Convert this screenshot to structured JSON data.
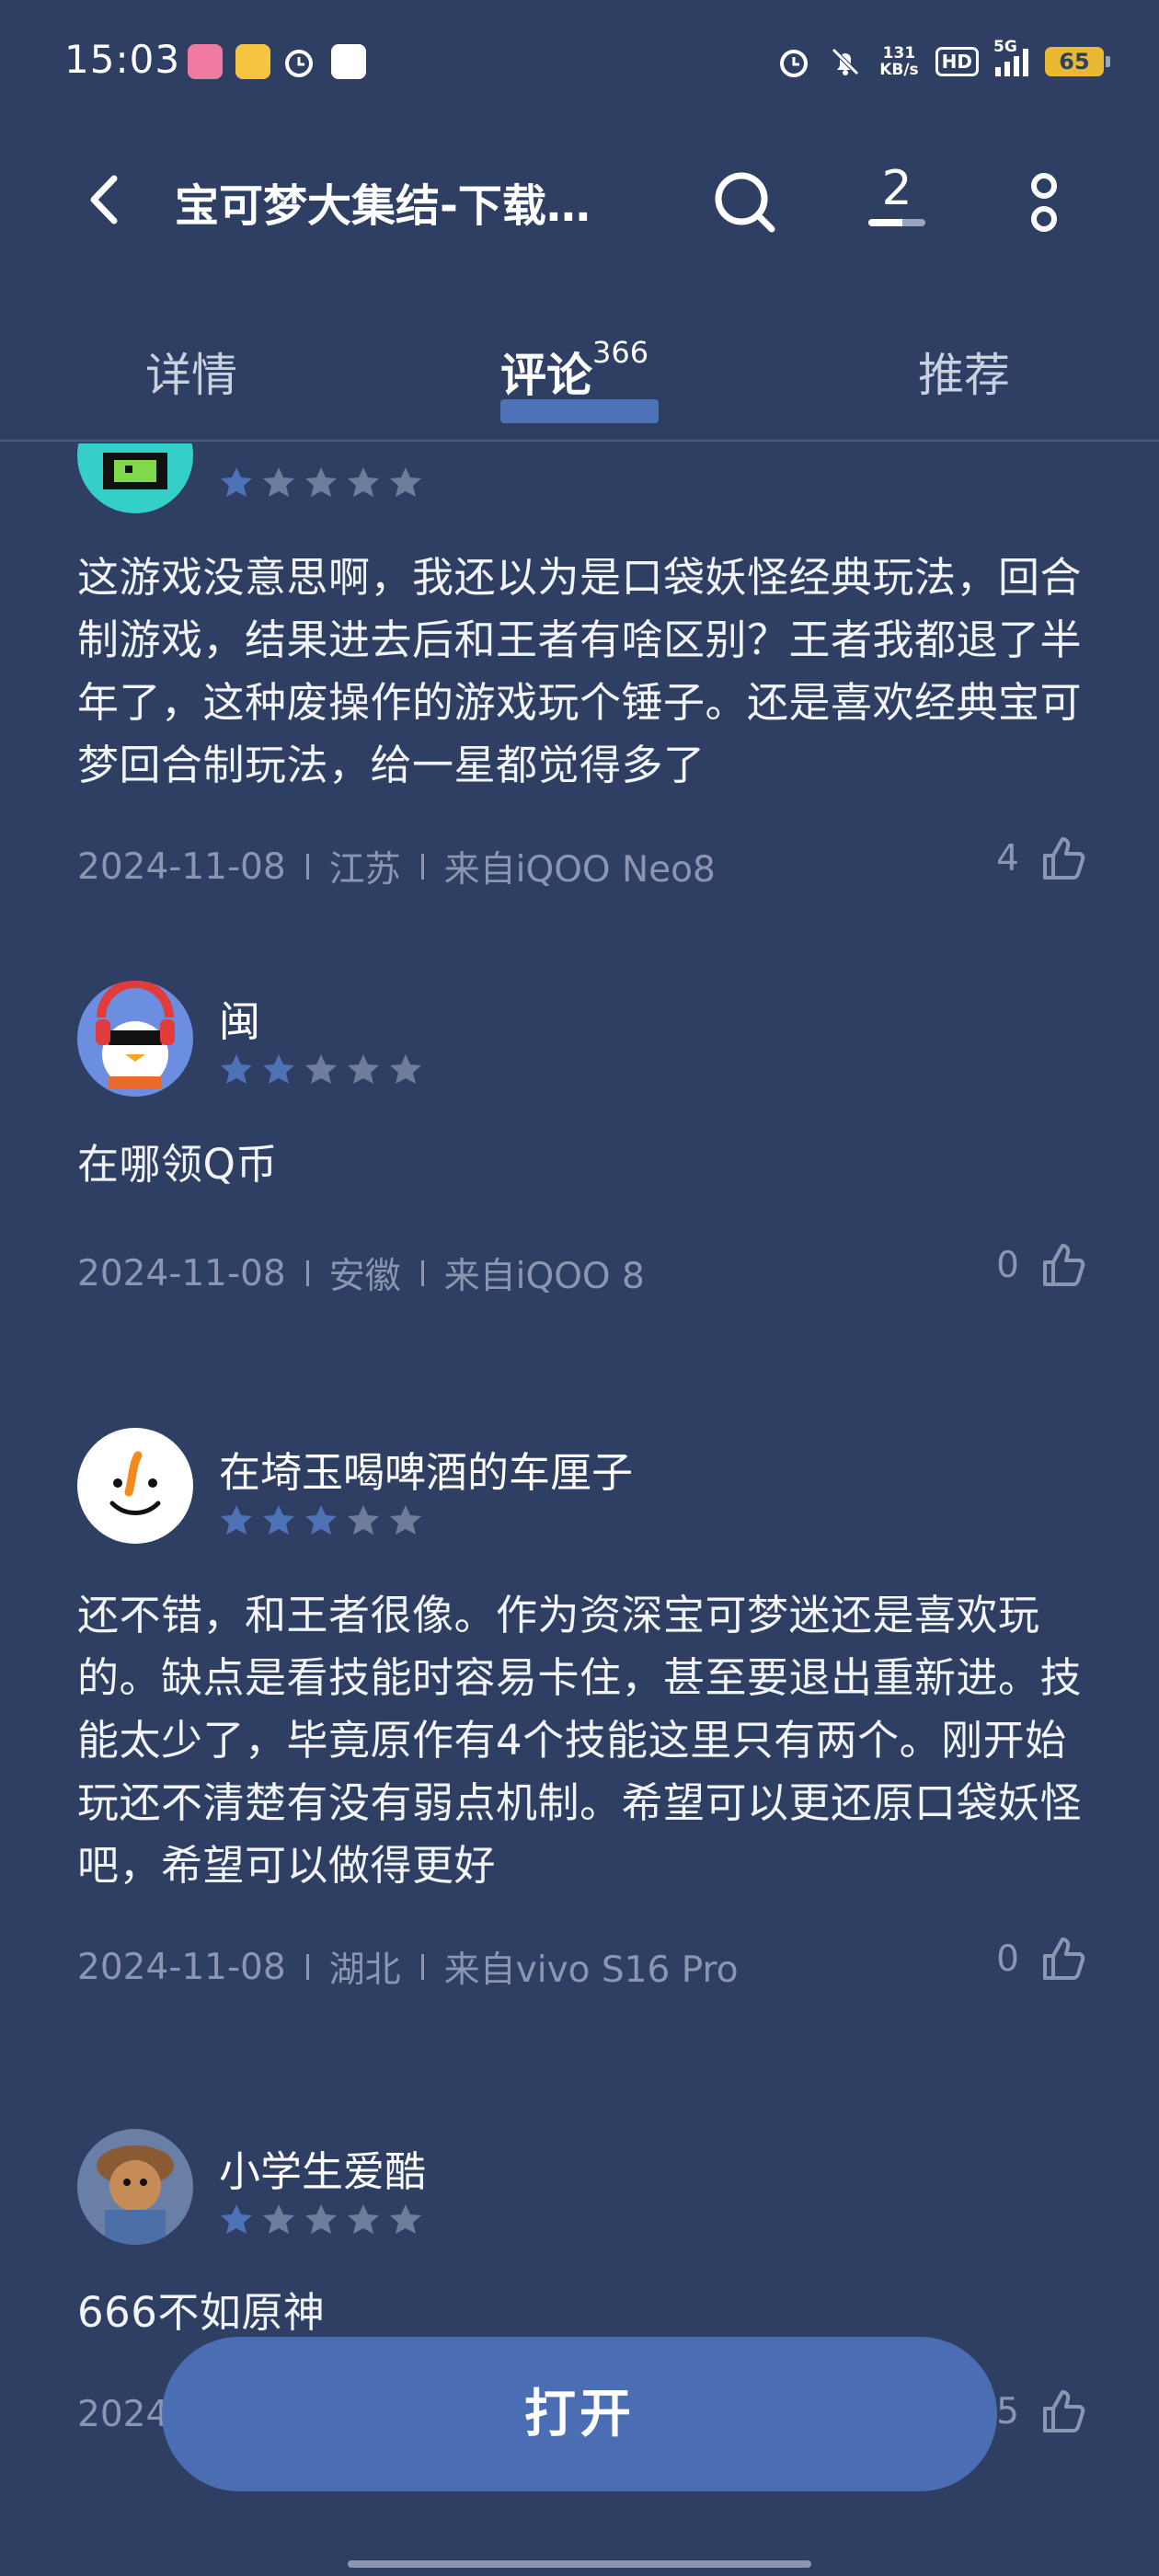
{
  "status": {
    "time": "15:03",
    "net_speed_top": "131",
    "net_speed_unit": "KB/s",
    "hd": "HD",
    "network": "5G",
    "battery": "65",
    "icons": [
      "bilibili-icon",
      "weibo-icon",
      "alarm-icon",
      "app-store-icon",
      "alarm-icon",
      "mute-bell-icon"
    ]
  },
  "header": {
    "title": "宝可梦大集结-下载…",
    "count": "2"
  },
  "tabs": [
    {
      "label": "详情"
    },
    {
      "label": "评论",
      "badge": "366"
    },
    {
      "label": "推荐"
    }
  ],
  "reviews": [
    {
      "rating": 1,
      "text": "这游戏没意思啊，我还以为是口袋妖怪经典玩法，回合制游戏，结果进去后和王者有啥区别？王者我都退了半年了，这种废操作的游戏玩个锤子。还是喜欢经典宝可梦回合制玩法，给一星都觉得多了",
      "date": "2024-11-08",
      "region": "江苏",
      "device": "来自iQOO Neo8",
      "likes": "4"
    },
    {
      "name": "闽",
      "rating": 2,
      "text": "在哪领Q币",
      "date": "2024-11-08",
      "region": "安徽",
      "device": "来自iQOO 8",
      "likes": "0"
    },
    {
      "name": "在埼玉喝啤酒的车厘子",
      "rating": 3,
      "text": "还不错，和王者很像。作为资深宝可梦迷还是喜欢玩的。缺点是看技能时容易卡住，甚至要退出重新进。技能太少了，毕竟原作有4个技能这里只有两个。刚开始玩还不清楚有没有弱点机制。希望可以更还原口袋妖怪吧，希望可以做得更好",
      "date": "2024-11-08",
      "region": "湖北",
      "device": "来自vivo S16 Pro",
      "likes": "0"
    },
    {
      "name": "小学生爱酷",
      "rating": 1,
      "text": "666不如原神",
      "date_partial": "2024",
      "likes_partial": "5"
    }
  ],
  "bottom": {
    "open_label": "打开"
  },
  "colors": {
    "background": "#2e3f63",
    "accent": "#4d72b8",
    "button": "#4a6db3",
    "star_active": "#4d72b8",
    "star_inactive": "#6f7d9c",
    "meta_text": "#8b97b2"
  }
}
